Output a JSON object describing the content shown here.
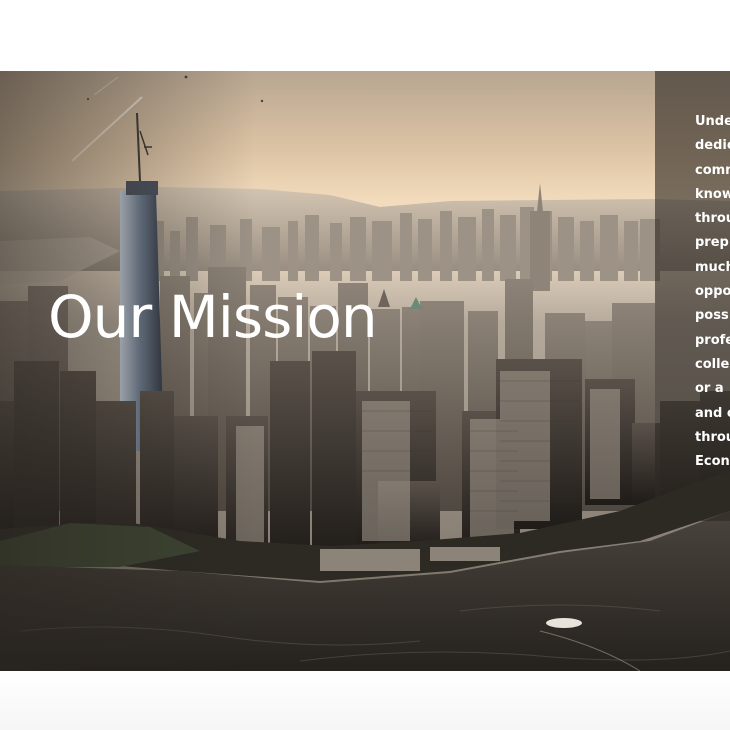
{
  "hero": {
    "title": "Our Mission",
    "image": "new-york-city-aerial-skyline",
    "panel_lines": [
      "Unde",
      "dedic",
      "comm",
      "know",
      "throu",
      "prep",
      "much",
      "oppo",
      "poss",
      "profe",
      "colle",
      "or a",
      "and c",
      "throu",
      "Econ"
    ]
  },
  "colors": {
    "sky_top": "#b9a894",
    "sky_glow": "#f5dcbc",
    "panel": "#2d2824",
    "water": "#2e2a26",
    "title_text": "#ffffff"
  }
}
